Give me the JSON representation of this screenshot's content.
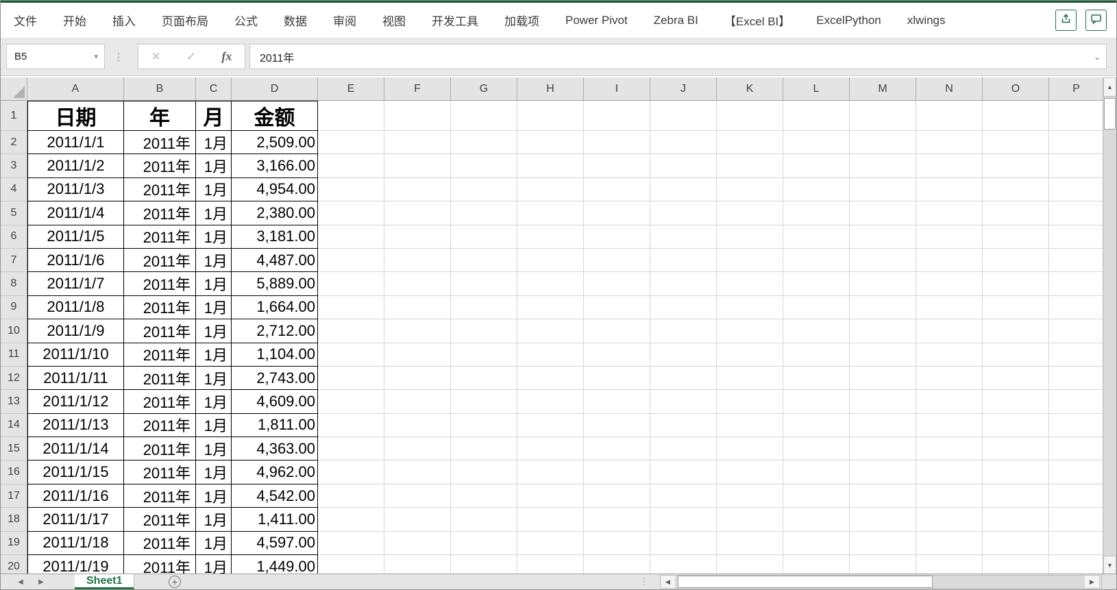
{
  "ribbon": {
    "tabs": [
      "文件",
      "开始",
      "插入",
      "页面布局",
      "公式",
      "数据",
      "审阅",
      "视图",
      "开发工具",
      "加载项",
      "Power Pivot",
      "Zebra BI",
      "【Excel BI】",
      "ExcelPython",
      "xlwings"
    ]
  },
  "formula_bar": {
    "name_box_value": "B5",
    "cancel_glyph": "✕",
    "enter_glyph": "✓",
    "fx_glyph": "fx",
    "value": "2011年",
    "dropdown_glyph": "▾",
    "expand_glyph": "⌄"
  },
  "sheet": {
    "selected_cell": "B5",
    "columns": [
      "A",
      "B",
      "C",
      "D",
      "E",
      "F",
      "G",
      "H",
      "I",
      "J",
      "K",
      "L",
      "M",
      "N",
      "O",
      "P"
    ],
    "header_row": {
      "n": 1,
      "cells": [
        "日期",
        "年",
        "月",
        "金额"
      ]
    },
    "rows": [
      {
        "n": 2,
        "date": "2011/1/1",
        "year": "2011年",
        "month": "1月",
        "amount": "2,509.00"
      },
      {
        "n": 3,
        "date": "2011/1/2",
        "year": "2011年",
        "month": "1月",
        "amount": "3,166.00"
      },
      {
        "n": 4,
        "date": "2011/1/3",
        "year": "2011年",
        "month": "1月",
        "amount": "4,954.00"
      },
      {
        "n": 5,
        "date": "2011/1/4",
        "year": "2011年",
        "month": "1月",
        "amount": "2,380.00"
      },
      {
        "n": 6,
        "date": "2011/1/5",
        "year": "2011年",
        "month": "1月",
        "amount": "3,181.00"
      },
      {
        "n": 7,
        "date": "2011/1/6",
        "year": "2011年",
        "month": "1月",
        "amount": "4,487.00"
      },
      {
        "n": 8,
        "date": "2011/1/7",
        "year": "2011年",
        "month": "1月",
        "amount": "5,889.00"
      },
      {
        "n": 9,
        "date": "2011/1/8",
        "year": "2011年",
        "month": "1月",
        "amount": "1,664.00"
      },
      {
        "n": 10,
        "date": "2011/1/9",
        "year": "2011年",
        "month": "1月",
        "amount": "2,712.00"
      },
      {
        "n": 11,
        "date": "2011/1/10",
        "year": "2011年",
        "month": "1月",
        "amount": "1,104.00"
      },
      {
        "n": 12,
        "date": "2011/1/11",
        "year": "2011年",
        "month": "1月",
        "amount": "2,743.00"
      },
      {
        "n": 13,
        "date": "2011/1/12",
        "year": "2011年",
        "month": "1月",
        "amount": "4,609.00"
      },
      {
        "n": 14,
        "date": "2011/1/13",
        "year": "2011年",
        "month": "1月",
        "amount": "1,811.00"
      },
      {
        "n": 15,
        "date": "2011/1/14",
        "year": "2011年",
        "month": "1月",
        "amount": "4,363.00"
      },
      {
        "n": 16,
        "date": "2011/1/15",
        "year": "2011年",
        "month": "1月",
        "amount": "4,962.00"
      },
      {
        "n": 17,
        "date": "2011/1/16",
        "year": "2011年",
        "month": "1月",
        "amount": "4,542.00"
      },
      {
        "n": 18,
        "date": "2011/1/17",
        "year": "2011年",
        "month": "1月",
        "amount": "1,411.00"
      },
      {
        "n": 19,
        "date": "2011/1/18",
        "year": "2011年",
        "month": "1月",
        "amount": "4,597.00"
      },
      {
        "n": 20,
        "date": "2011/1/19",
        "year": "2011年",
        "month": "1月",
        "amount": "1,449.00"
      }
    ]
  },
  "bottom_bar": {
    "sheet_tab_label": "Sheet1",
    "add_sheet_glyph": "+",
    "prev_glyph": "◀",
    "next_glyph": "▶"
  },
  "scrollbars": {
    "up_glyph": "▲",
    "down_glyph": "▼",
    "left_glyph": "◀",
    "right_glyph": "▶"
  },
  "colors": {
    "accent_green": "#217346",
    "title_line_green": "#185c37",
    "header_bg": "#e4e4e4",
    "grid_line": "#d6d6d6",
    "table_border": "#000000"
  }
}
